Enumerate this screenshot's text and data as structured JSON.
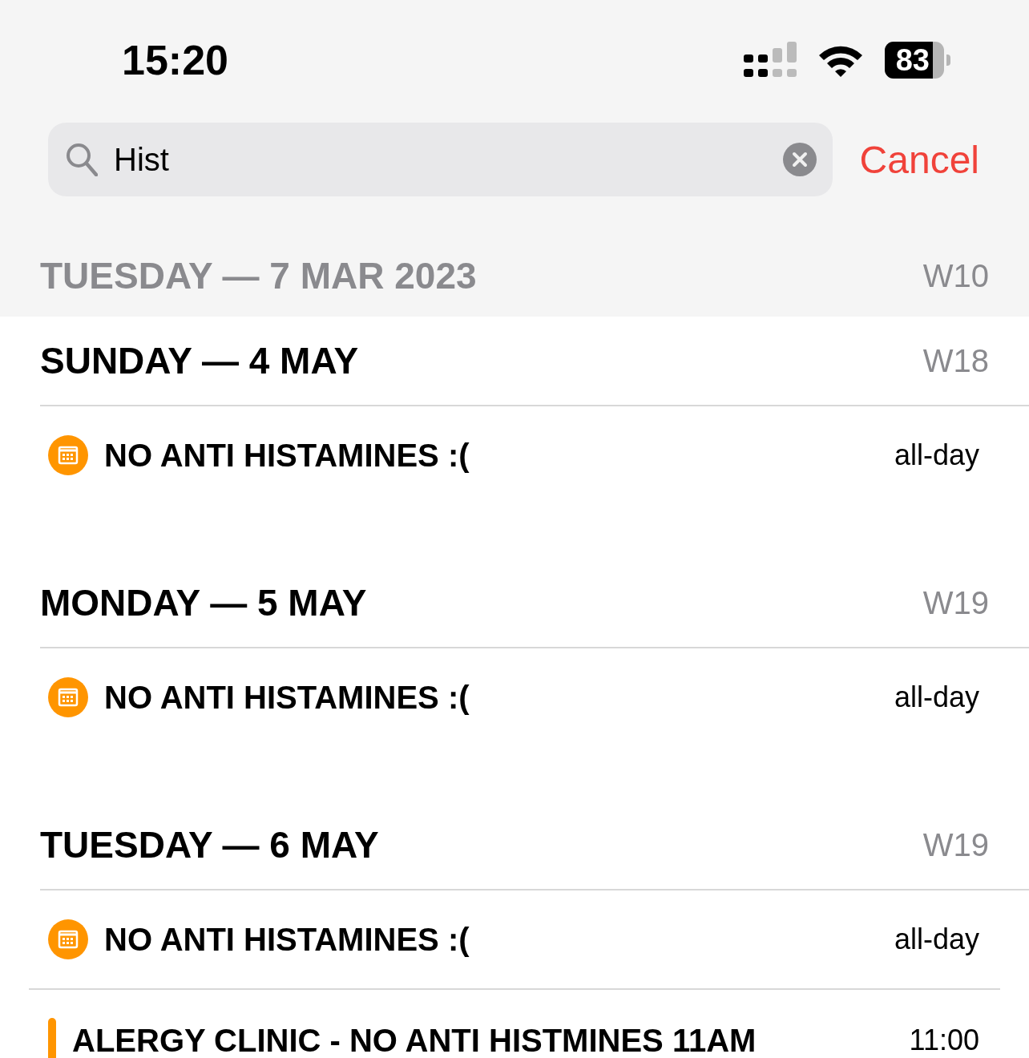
{
  "status_bar": {
    "time": "15:20",
    "battery": "83"
  },
  "search": {
    "value": "Hist",
    "cancel": "Cancel"
  },
  "pinned_header": {
    "date": "TUESDAY — 7 MAR 2023",
    "week": "W10"
  },
  "days": [
    {
      "date": "SUNDAY — 4 MAY",
      "week": "W18",
      "events": [
        {
          "kind": "all-day",
          "title": "NO ANTI HISTAMINES :(",
          "time": "all-day",
          "color": "#ff9500"
        }
      ]
    },
    {
      "date": "MONDAY — 5 MAY",
      "week": "W19",
      "events": [
        {
          "kind": "all-day",
          "title": "NO ANTI HISTAMINES :(",
          "time": "all-day",
          "color": "#ff9500"
        }
      ]
    },
    {
      "date": "TUESDAY — 6 MAY",
      "week": "W19",
      "events": [
        {
          "kind": "all-day",
          "title": "NO ANTI HISTAMINES :(",
          "time": "all-day",
          "color": "#ff9500"
        },
        {
          "kind": "timed",
          "title": "ALERGY CLINIC - NO ANTI HISTMINES 11AM",
          "time": "11:00",
          "color": "#ff9500"
        }
      ]
    }
  ]
}
